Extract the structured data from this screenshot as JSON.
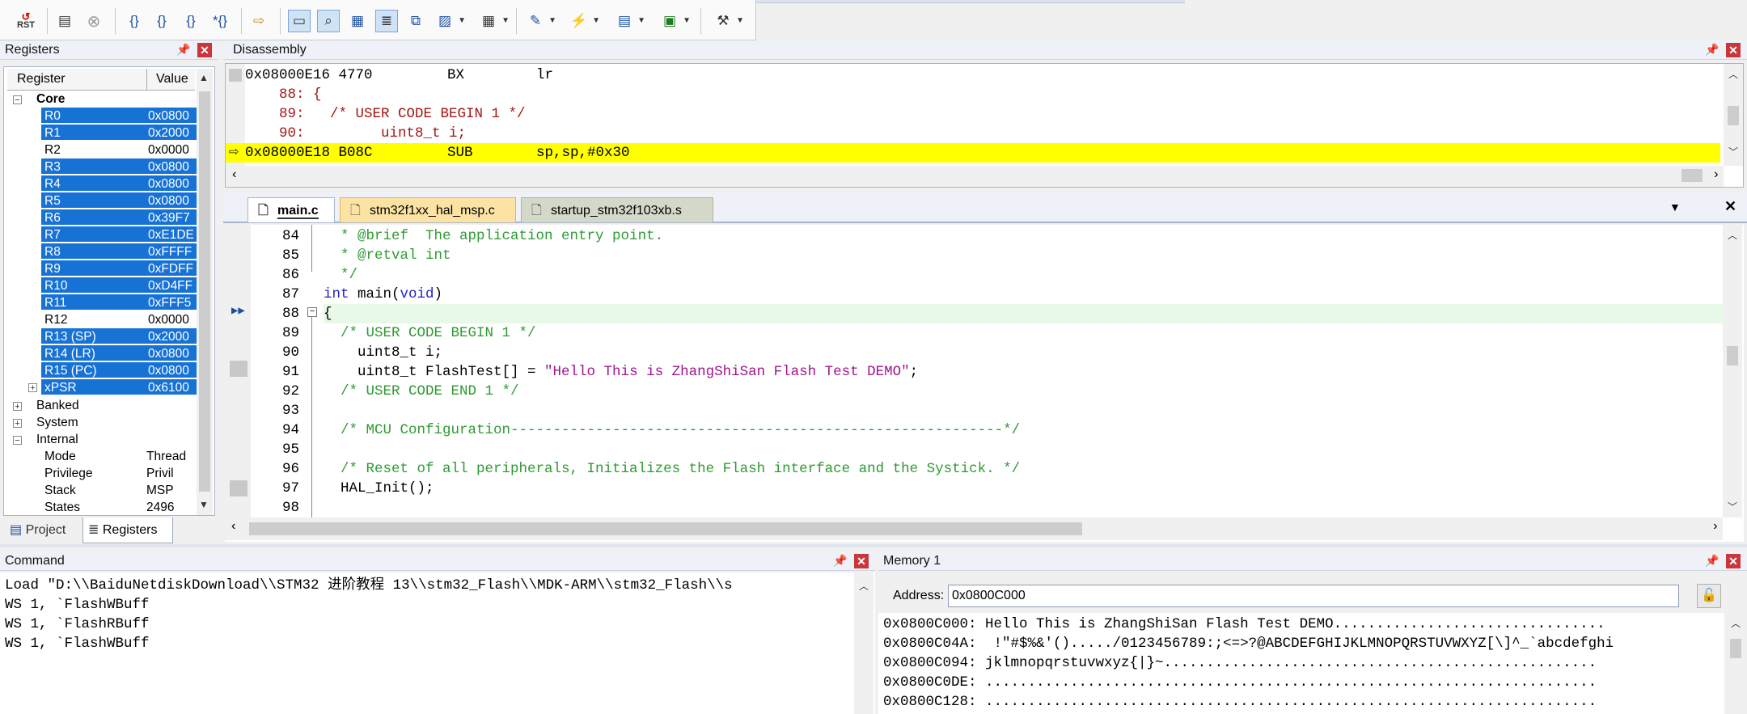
{
  "toolbar": {
    "buttons": [
      {
        "icon": "reset-icon",
        "label": "RST"
      },
      {
        "icon": "registers-window-icon"
      },
      {
        "icon": "stop-debug-icon"
      },
      {
        "icon": "step-icon"
      },
      {
        "icon": "step-over-icon"
      },
      {
        "icon": "step-out-icon"
      },
      {
        "icon": "run-to-cursor-icon"
      },
      {
        "icon": "show-next-statement-icon"
      },
      {
        "icon": "command-window-icon"
      },
      {
        "icon": "disassembly-window-icon"
      },
      {
        "icon": "symbols-window-icon"
      },
      {
        "icon": "registers-list-icon"
      },
      {
        "icon": "call-stack-icon"
      },
      {
        "icon": "watch-window-icon"
      },
      {
        "icon": "memory-window-icon"
      },
      {
        "icon": "serial-window-icon"
      },
      {
        "icon": "analysis-window-icon"
      },
      {
        "icon": "trace-window-icon"
      },
      {
        "icon": "system-viewer-icon"
      },
      {
        "icon": "toolbox-icon"
      }
    ]
  },
  "registers": {
    "title": "Registers",
    "col_register": "Register",
    "col_value": "Value",
    "core_label": "Core",
    "rows": [
      {
        "name": "R0",
        "value": "0x0800",
        "selected": true
      },
      {
        "name": "R1",
        "value": "0x2000",
        "selected": true
      },
      {
        "name": "R2",
        "value": "0x0000",
        "selected": false
      },
      {
        "name": "R3",
        "value": "0x0800",
        "selected": true
      },
      {
        "name": "R4",
        "value": "0x0800",
        "selected": true
      },
      {
        "name": "R5",
        "value": "0x0800",
        "selected": true
      },
      {
        "name": "R6",
        "value": "0x39F7",
        "selected": true
      },
      {
        "name": "R7",
        "value": "0xE1DE",
        "selected": true
      },
      {
        "name": "R8",
        "value": "0xFFFF",
        "selected": true
      },
      {
        "name": "R9",
        "value": "0xFDFF",
        "selected": true
      },
      {
        "name": "R10",
        "value": "0xD4FF",
        "selected": true
      },
      {
        "name": "R11",
        "value": "0xFFF5",
        "selected": true
      },
      {
        "name": "R12",
        "value": "0x0000",
        "selected": false
      },
      {
        "name": "R13 (SP)",
        "value": "0x2000",
        "selected": true
      },
      {
        "name": "R14 (LR)",
        "value": "0x0800",
        "selected": true
      },
      {
        "name": "R15 (PC)",
        "value": "0x0800",
        "selected": true
      },
      {
        "name": "xPSR",
        "value": "0x6100",
        "selected": true
      }
    ],
    "groups": [
      "Banked",
      "System",
      "Internal"
    ],
    "internal_rows": [
      {
        "name": "Mode",
        "value": "Thread"
      },
      {
        "name": "Privilege",
        "value": "Privil"
      },
      {
        "name": "Stack",
        "value": "MSP"
      },
      {
        "name": "States",
        "value": "2496"
      }
    ],
    "bottom_tabs": [
      "Project",
      "Registers"
    ]
  },
  "disassembly": {
    "title": "Disassembly",
    "lines": [
      {
        "addr": "0x08000E16",
        "code": "4770",
        "mnemonic": "BX",
        "operands": "lr"
      },
      {
        "source": "    88: {"
      },
      {
        "source": "    89:   /* USER CODE BEGIN 1 */"
      },
      {
        "source": "    90:         uint8_t i;"
      },
      {
        "addr": "0x08000E18",
        "code": "B08C",
        "mnemonic": "SUB",
        "operands": "sp,sp,#0x30"
      }
    ]
  },
  "editor": {
    "tabs": [
      "main.c",
      "stm32f1xx_hal_msp.c",
      "startup_stm32f103xb.s"
    ],
    "lines": [
      {
        "n": "84",
        "text": "  * @brief  The application entry point."
      },
      {
        "n": "85",
        "text": "  * @retval int"
      },
      {
        "n": "86",
        "text": "  */"
      },
      {
        "n": "87",
        "kw": "int",
        "fn": " main(",
        "kw2": "void",
        "tail": ")"
      },
      {
        "n": "88",
        "text": "{"
      },
      {
        "n": "89",
        "text": "  /* USER CODE BEGIN 1 */"
      },
      {
        "n": "90",
        "text": "    uint8_t i;"
      },
      {
        "n": "91",
        "pre": "    uint8_t FlashTest[] = ",
        "str": "\"Hello This is ZhangShiSan Flash Test DEMO\"",
        "post": ";"
      },
      {
        "n": "92",
        "text": "  /* USER CODE END 1 */"
      },
      {
        "n": "93",
        "text": ""
      },
      {
        "n": "94",
        "text": "  /* MCU Configuration----------------------------------------------------------*/"
      },
      {
        "n": "95",
        "text": ""
      },
      {
        "n": "96",
        "text": "  /* Reset of all peripherals, Initializes the Flash interface and the Systick. */"
      },
      {
        "n": "97",
        "text": "  HAL_Init();"
      },
      {
        "n": "98",
        "text": ""
      }
    ]
  },
  "command": {
    "title": "Command",
    "lines": [
      "Load \"D:\\\\BaiduNetdiskDownload\\\\STM32 进阶教程 13\\\\stm32_Flash\\\\MDK-ARM\\\\stm32_Flash\\\\s",
      "WS 1, `FlashWBuff",
      "WS 1, `FlashRBuff",
      "WS 1, `FlashWBuff"
    ]
  },
  "memory": {
    "title": "Memory 1",
    "address_label": "Address:",
    "address_value": "0x0800C000",
    "lines": [
      "0x0800C000: Hello This is ZhangShiSan Flash Test DEMO................................",
      "0x0800C04A:  !\"#$%&'()...../0123456789:;<=>?@ABCDEFGHIJKLMNOPQRSTUVWXYZ[\\]^_`abcdefghi",
      "0x0800C094: jklmnopqrstuvwxyz{|}~...................................................",
      "0x0800C0DE: ........................................................................",
      "0x0800C128: ........................................................................"
    ]
  }
}
